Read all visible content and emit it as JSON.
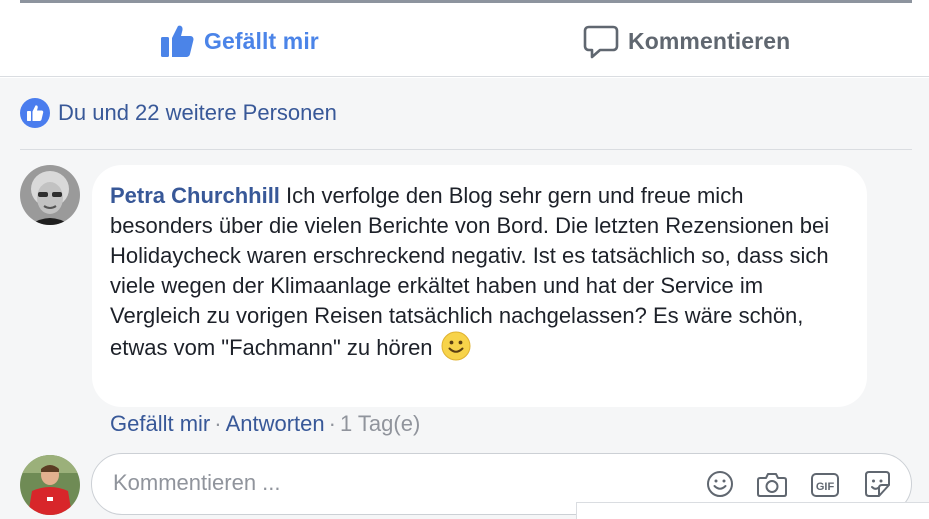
{
  "actions": {
    "like_label": "Gefällt mir",
    "comment_label": "Kommentieren"
  },
  "reactions": {
    "summary": "Du und 22 weitere Personen"
  },
  "comment": {
    "author": "Petra Churchhill",
    "text": "Ich verfolge den Blog sehr gern und freue mich besonders über die vielen Berichte von Bord. Die letzten Rezensionen bei Holidaycheck waren erschreckend negativ. Ist es tatsächlich so, dass sich viele wegen der Klimaanlage erkältet haben und hat der Service im Vergleich zu vorigen Reisen tatsächlich nachgelassen? Es wäre schön, etwas vom \"Fachmann\" zu hören",
    "emoji": "smiley-emoji",
    "like_link": "Gefällt mir",
    "separator": "·",
    "reply_link": "Antworten",
    "timestamp": "1 Tag(e)"
  },
  "composer": {
    "placeholder": "Kommentieren ...",
    "tools": [
      "emoji-icon",
      "camera-icon",
      "gif-icon",
      "sticker-icon"
    ]
  },
  "colors": {
    "accent": "#4b84e8",
    "link": "#385898",
    "muted": "#90949c",
    "panel_bg": "#f5f6f7"
  }
}
